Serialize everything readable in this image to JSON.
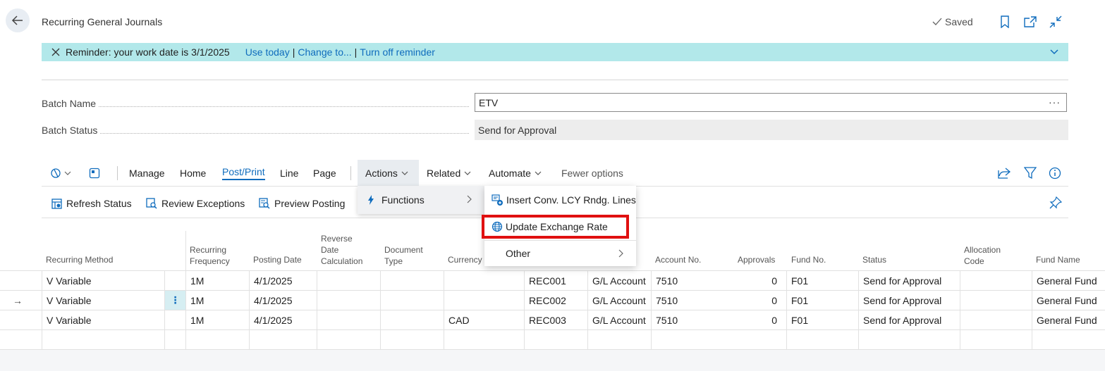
{
  "header": {
    "title": "Recurring General Journals",
    "saved_label": "Saved"
  },
  "reminder": {
    "text": "Reminder: your work date is 3/1/2025",
    "use_today": "Use today",
    "change_to": "Change to...",
    "turn_off": "Turn off reminder",
    "separator": "|"
  },
  "fields": {
    "batch_name_label": "Batch Name",
    "batch_name_value": "ETV",
    "batch_status_label": "Batch Status",
    "batch_status_value": "Send for Approval",
    "more_glyph": "···"
  },
  "toolbar": {
    "manage": "Manage",
    "home": "Home",
    "post_print": "Post/Print",
    "line": "Line",
    "page": "Page",
    "actions": "Actions",
    "related": "Related",
    "automate": "Automate",
    "fewer_options": "Fewer options"
  },
  "subbar": {
    "refresh_status": "Refresh Status",
    "review_exceptions": "Review Exceptions",
    "preview_posting": "Preview Posting"
  },
  "menus": {
    "functions": "Functions",
    "insert_conv": "Insert Conv. LCY Rndg. Lines",
    "update_exchange_rate": "Update Exchange Rate",
    "other": "Other"
  },
  "table": {
    "headers": {
      "recurring_method": "Recurring Method",
      "recurring_frequency_1": "Recurring",
      "recurring_frequency_2": "Frequency",
      "posting_date": "Posting Date",
      "reverse_1": "Reverse",
      "reverse_2": "Date",
      "reverse_3": "Calculation",
      "document_1": "Document",
      "document_2": "Type",
      "currency": "Currency C",
      "account_no": "Account No.",
      "approvals": "Approvals",
      "fund_no": "Fund No.",
      "status": "Status",
      "allocation_1": "Allocation",
      "allocation_2": "Code",
      "fund_name": "Fund Name"
    },
    "rows": [
      {
        "method": "V  Variable",
        "freq": "1M",
        "posting": "4/1/2025",
        "currency": "",
        "doc_no": "REC001",
        "acc_type": "G/L Account",
        "acc_no": "7510",
        "approvals": "0",
        "fund_no": "F01",
        "status": "Send for Approval",
        "fund_name": "General Fund"
      },
      {
        "method": "V  Variable",
        "freq": "1M",
        "posting": "4/1/2025",
        "currency": "",
        "doc_no": "REC002",
        "acc_type": "G/L Account",
        "acc_no": "7510",
        "approvals": "0",
        "fund_no": "F01",
        "status": "Send for Approval",
        "fund_name": "General Fund"
      },
      {
        "method": "V  Variable",
        "freq": "1M",
        "posting": "4/1/2025",
        "currency": "CAD",
        "doc_no": "REC003",
        "acc_type": "G/L Account",
        "acc_no": "7510",
        "approvals": "0",
        "fund_no": "F01",
        "status": "Send for Approval",
        "fund_name": "General Fund"
      }
    ],
    "row_menu_glyph": "⋮",
    "current_row_glyph": "→"
  },
  "icons": {
    "back": "arrow-left-icon",
    "saved": "checkmark-icon",
    "bookmark": "bookmark-icon",
    "popout": "popout-icon",
    "collapse": "collapse-icon",
    "close": "close-icon",
    "chevron": "chevron-down-icon",
    "share": "share-icon",
    "filter": "filter-icon",
    "info": "info-icon",
    "pin": "pin-icon",
    "bolt": "bolt-icon"
  },
  "colors": {
    "accent": "#0f6cbd",
    "reminder_bg": "#b2e8ea",
    "highlight": "#e01010"
  }
}
